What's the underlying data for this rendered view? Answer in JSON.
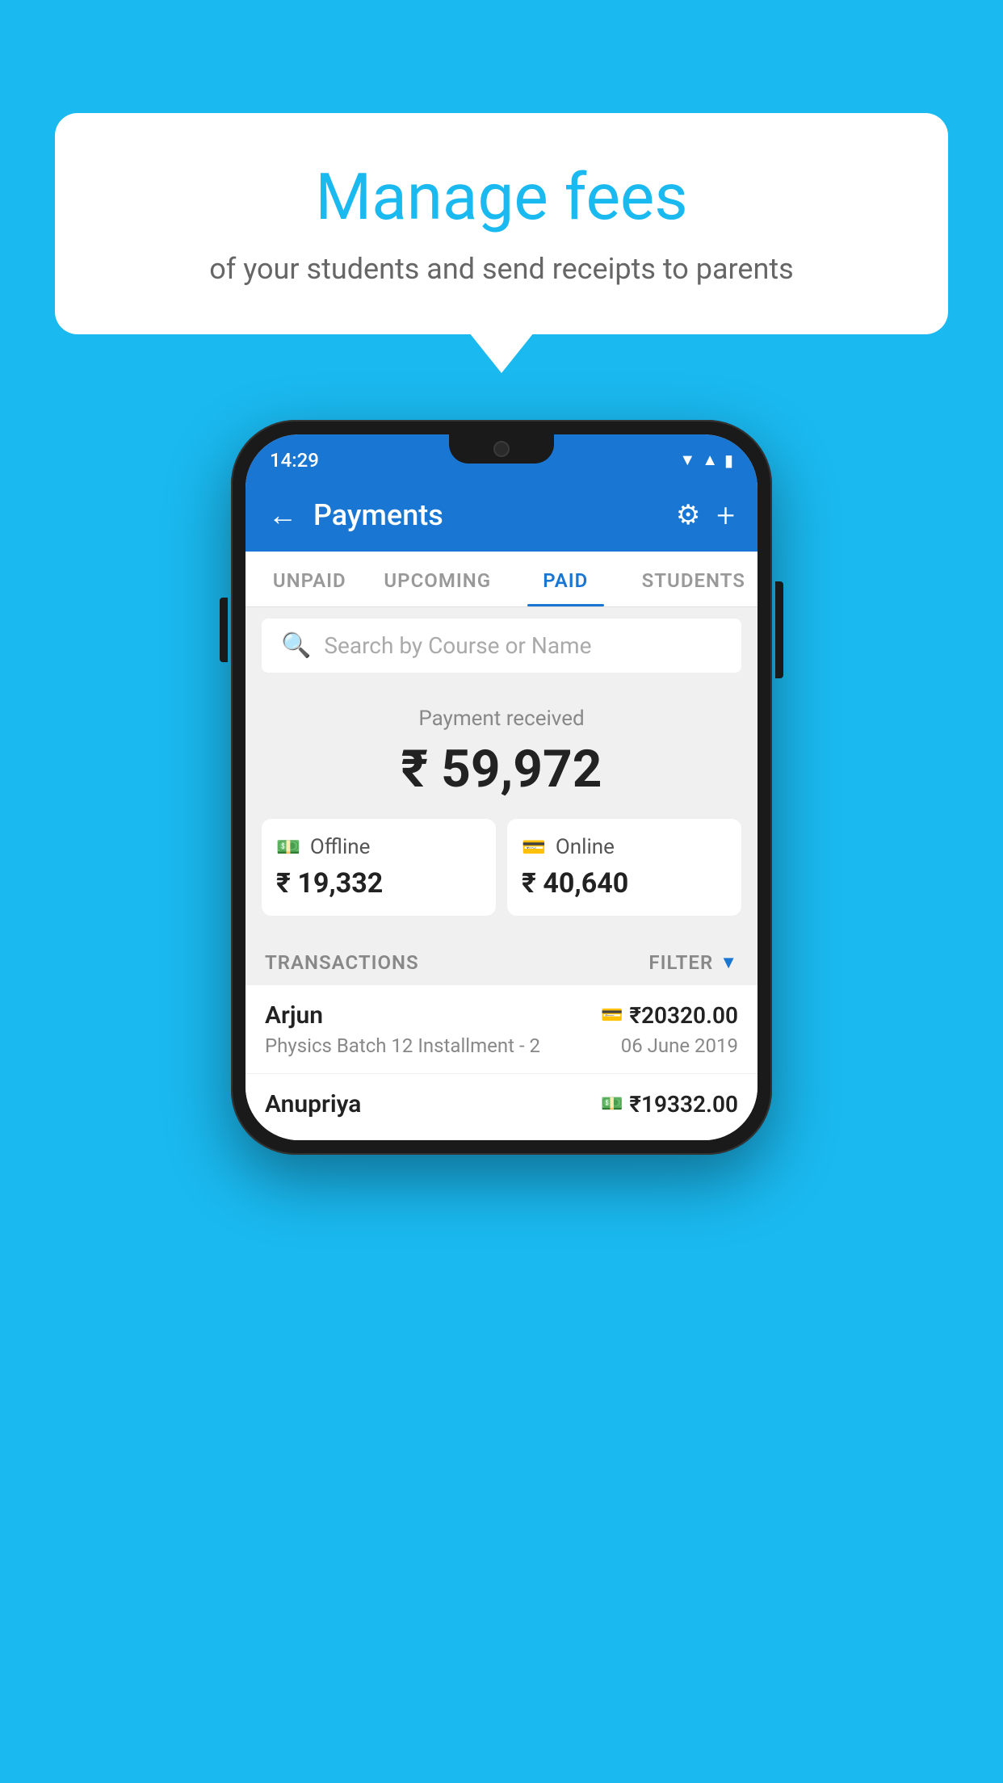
{
  "background_color": "#1ab9f0",
  "speech_bubble": {
    "title": "Manage fees",
    "subtitle": "of your students and send receipts to parents"
  },
  "phone": {
    "status_bar": {
      "time": "14:29",
      "icons": [
        "wifi",
        "signal",
        "battery"
      ]
    },
    "header": {
      "title": "Payments",
      "back_label": "←",
      "gear_label": "⚙",
      "plus_label": "+"
    },
    "tabs": [
      {
        "label": "UNPAID",
        "active": false
      },
      {
        "label": "UPCOMING",
        "active": false
      },
      {
        "label": "PAID",
        "active": true
      },
      {
        "label": "STUDENTS",
        "active": false
      }
    ],
    "search": {
      "placeholder": "Search by Course or Name"
    },
    "payment_summary": {
      "label": "Payment received",
      "amount": "₹ 59,972",
      "offline": {
        "type": "Offline",
        "amount": "₹ 19,332"
      },
      "online": {
        "type": "Online",
        "amount": "₹ 40,640"
      }
    },
    "transactions": {
      "label": "TRANSACTIONS",
      "filter_label": "FILTER",
      "rows": [
        {
          "name": "Arjun",
          "amount": "₹20320.00",
          "course": "Physics Batch 12 Installment - 2",
          "date": "06 June 2019",
          "icon_type": "card"
        },
        {
          "name": "Anupriya",
          "amount": "₹19332.00",
          "course": "",
          "date": "",
          "icon_type": "cash"
        }
      ]
    }
  }
}
